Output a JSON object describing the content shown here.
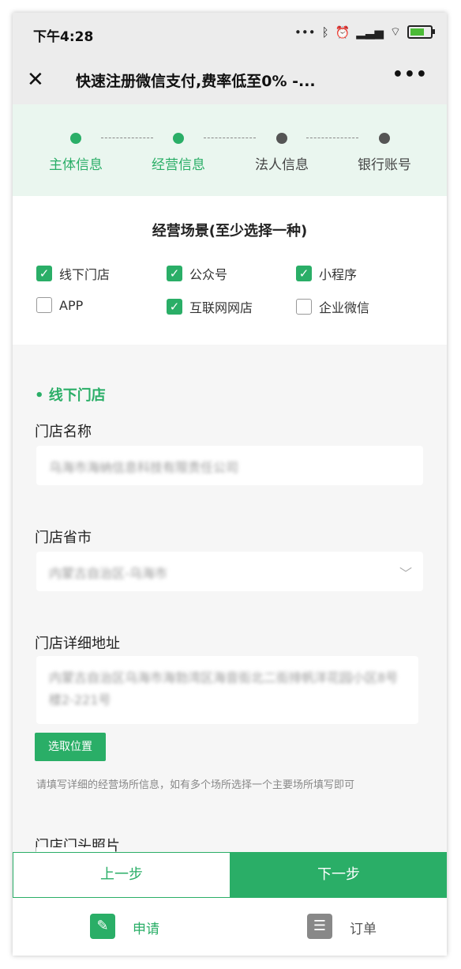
{
  "status": {
    "time": "下午4:28",
    "icons": [
      "more-dots-icon",
      "bluetooth-icon",
      "alarm-icon",
      "signal-icon",
      "wifi-icon",
      "battery-icon"
    ]
  },
  "nav": {
    "title": "快速注册微信支付,费率低至0% -...",
    "close_icon": "close-icon",
    "more_icon": "more-icon"
  },
  "steps": [
    {
      "label": "主体信息",
      "state": "done"
    },
    {
      "label": "经营信息",
      "state": "done"
    },
    {
      "label": "法人信息",
      "state": "todo"
    },
    {
      "label": "银行账号",
      "state": "todo"
    }
  ],
  "scene": {
    "heading": "经营场景(至少选择一种)",
    "options": [
      {
        "label": "线下门店",
        "checked": true
      },
      {
        "label": "公众号",
        "checked": true
      },
      {
        "label": "小程序",
        "checked": true
      },
      {
        "label": "APP",
        "checked": false
      },
      {
        "label": "互联网网店",
        "checked": true
      },
      {
        "label": "企业微信",
        "checked": false
      }
    ]
  },
  "store": {
    "section_title": "• 线下门店",
    "name_label": "门店名称",
    "name_value": "乌海市海纳信息科技有限责任公司",
    "city_label": "门店省市",
    "city_value": "内蒙古自治区-乌海市",
    "address_label": "门店详细地址",
    "address_value": "内蒙古自治区乌海市海勃湾区海音街北二街排帆洋花园小区8号楼2-221号",
    "pick_button": "选取位置",
    "hint": "请填写详细的经营场所信息，如有多个场所选择一个主要场所填写即可",
    "photo_label": "门店门头照片"
  },
  "actions": {
    "prev": "上一步",
    "next": "下一步"
  },
  "tabs": [
    {
      "label": "申请",
      "icon": "apply-icon",
      "active": true
    },
    {
      "label": "订单",
      "icon": "order-clipboard-icon",
      "active": false
    }
  ],
  "colors": {
    "accent": "#2aae67",
    "steps_bg": "#eaf6ef",
    "inactive": "#555555"
  }
}
